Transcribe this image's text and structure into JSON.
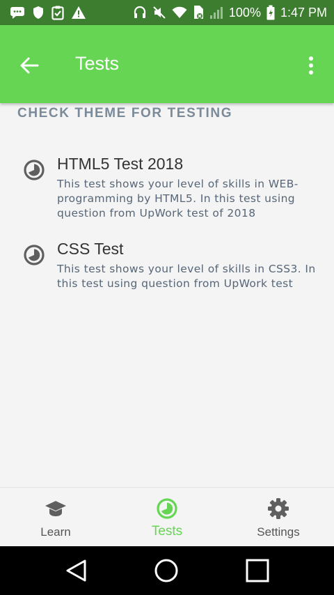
{
  "status_bar": {
    "battery_percent": "100%",
    "time": "1:47 PM",
    "left_icons": [
      "chat-icon",
      "shield-icon",
      "clipboard-check-icon",
      "warning-icon"
    ],
    "right_icons": [
      "headset-icon",
      "mute-icon",
      "wifi-icon",
      "sim-icon",
      "signal-icon",
      "battery-icon"
    ]
  },
  "app_bar": {
    "title": "Tests",
    "color": "#66d554"
  },
  "section": {
    "header": "CHECK THEME FOR TESTING"
  },
  "tests": [
    {
      "title": "HTML5 Test 2018",
      "description": "This test shows your level of skills in WEB-programming by HTML5. In this test using question from UpWork test of 2018",
      "icon": "timer-icon"
    },
    {
      "title": "CSS Test",
      "description": "This test shows your level of skills in CSS3. In this test using question from UpWork test",
      "icon": "timer-icon"
    }
  ],
  "bottom_nav": {
    "items": [
      {
        "label": "Learn",
        "icon": "graduation-cap-icon",
        "active": false
      },
      {
        "label": "Tests",
        "icon": "timer-icon",
        "active": true
      },
      {
        "label": "Settings",
        "icon": "gear-icon",
        "active": false
      }
    ],
    "active_color": "#66d554"
  },
  "system_nav": [
    "back-triangle-icon",
    "home-circle-icon",
    "recents-square-icon"
  ]
}
